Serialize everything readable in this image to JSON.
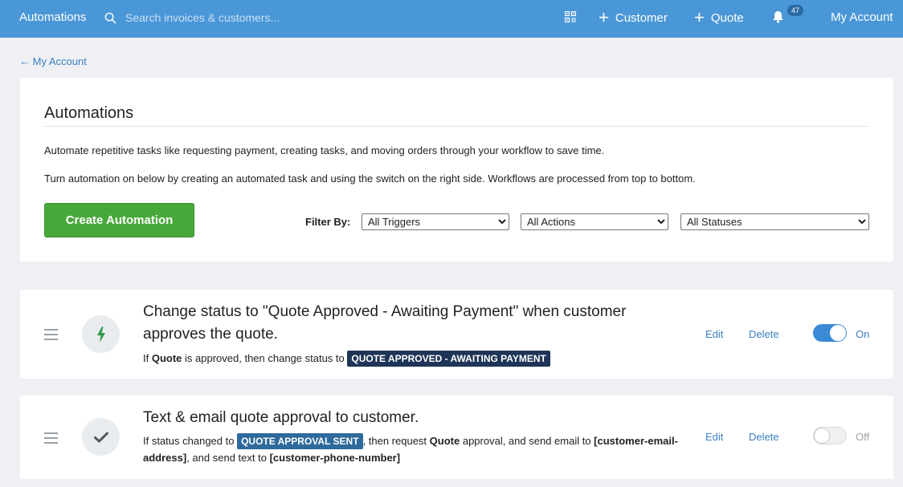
{
  "topbar": {
    "brand": "Automations",
    "search_placeholder": "Search invoices & customers...",
    "customer_label": "Customer",
    "quote_label": "Quote",
    "notification_count": "47",
    "account_label": "My Account"
  },
  "back_link": "← My Account",
  "main": {
    "title": "Automations",
    "description_1": "Automate repetitive tasks like requesting payment, creating tasks, and moving orders through your workflow to save time.",
    "description_2": "Turn automation on below by creating an automated task and using the switch on the right side. Workflows are processed from top to bottom.",
    "create_button": "Create Automation",
    "filter_label": "Filter By:",
    "filters": {
      "triggers": "All Triggers",
      "actions": "All Actions",
      "statuses": "All Statuses"
    }
  },
  "automations": [
    {
      "icon": "lightning-icon",
      "title": "Change status to \"Quote Approved - Awaiting Payment\" when customer approves the quote.",
      "detail_prefix": "If ",
      "detail_bold_1": "Quote",
      "detail_mid": " is approved, then change status to ",
      "tag": "QUOTE APPROVED - AWAITING PAYMENT",
      "edit": "Edit",
      "delete": "Delete",
      "state": "On",
      "enabled": true
    },
    {
      "icon": "check-icon",
      "title": "Text & email quote approval to customer.",
      "detail_prefix": "If status changed to ",
      "tag": "QUOTE APPROVAL SENT",
      "detail_mid": ", then request ",
      "detail_bold_1": "Quote",
      "detail_mid_2": " approval, and send email to ",
      "detail_bold_2": "[customer-email-address]",
      "detail_mid_3": ", and send text to ",
      "detail_bold_3": "[customer-phone-number]",
      "edit": "Edit",
      "delete": "Delete",
      "state": "Off",
      "enabled": false
    }
  ],
  "colors": {
    "topbar": "#4a97d8",
    "create_button": "#47a83a",
    "link": "#3a7fc0",
    "toggle_on": "#3a8ad6",
    "tag_dark": "#1e3557",
    "tag_blue": "#2e6a9b"
  }
}
